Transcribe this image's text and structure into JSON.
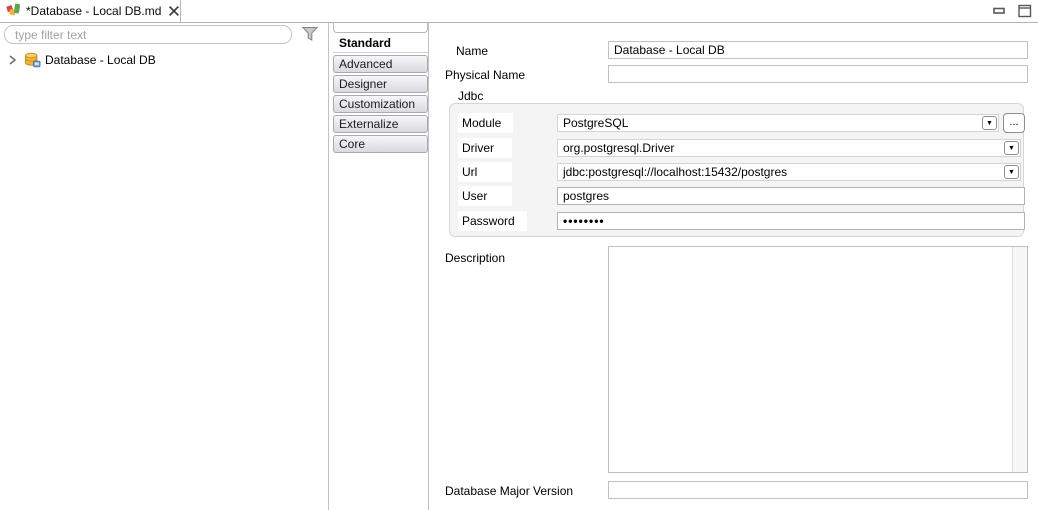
{
  "window": {
    "controls": {
      "minimize": "minimize",
      "maximize": "maximize"
    }
  },
  "editor_tab": {
    "title": "*Database - Local DB.md"
  },
  "explorer": {
    "filter_placeholder": "type filter text",
    "tree_items": [
      {
        "label": "Database - Local DB",
        "expanded": false
      }
    ]
  },
  "category_tabs": {
    "items": [
      {
        "label": "Standard",
        "selected": true
      },
      {
        "label": "Advanced",
        "selected": false
      },
      {
        "label": "Designer",
        "selected": false
      },
      {
        "label": "Customization",
        "selected": false
      },
      {
        "label": "Externalize",
        "selected": false
      },
      {
        "label": "Core",
        "selected": false
      }
    ]
  },
  "form": {
    "name_label": "Name",
    "name_value": "Database - Local DB",
    "physical_name_label": "Physical Name",
    "physical_name_value": "",
    "jdbc": {
      "group_label": "Jdbc",
      "module_label": "Module",
      "module_value": "PostgreSQL",
      "browse_button": "...",
      "driver_label": "Driver",
      "driver_value": "org.postgresql.Driver",
      "url_label": "Url",
      "url_value": "jdbc:postgresql://localhost:15432/postgres",
      "user_label": "User",
      "user_value": "postgres",
      "password_label": "Password",
      "password_value": "••••••••"
    },
    "description_label": "Description",
    "description_value": "",
    "db_major_version_label": "Database Major Version",
    "db_major_version_value": ""
  },
  "icons": {
    "dropdown_glyph": "▼"
  },
  "colors": {
    "panel_border": "#b4b4b4",
    "group_bg": "#f4f4f4",
    "tab_gradient_top": "#f7f7f9",
    "tab_gradient_bottom": "#d9d9df",
    "db_icon_yellow": "#f2b632",
    "db_icon_blue": "#7fb0e2"
  }
}
